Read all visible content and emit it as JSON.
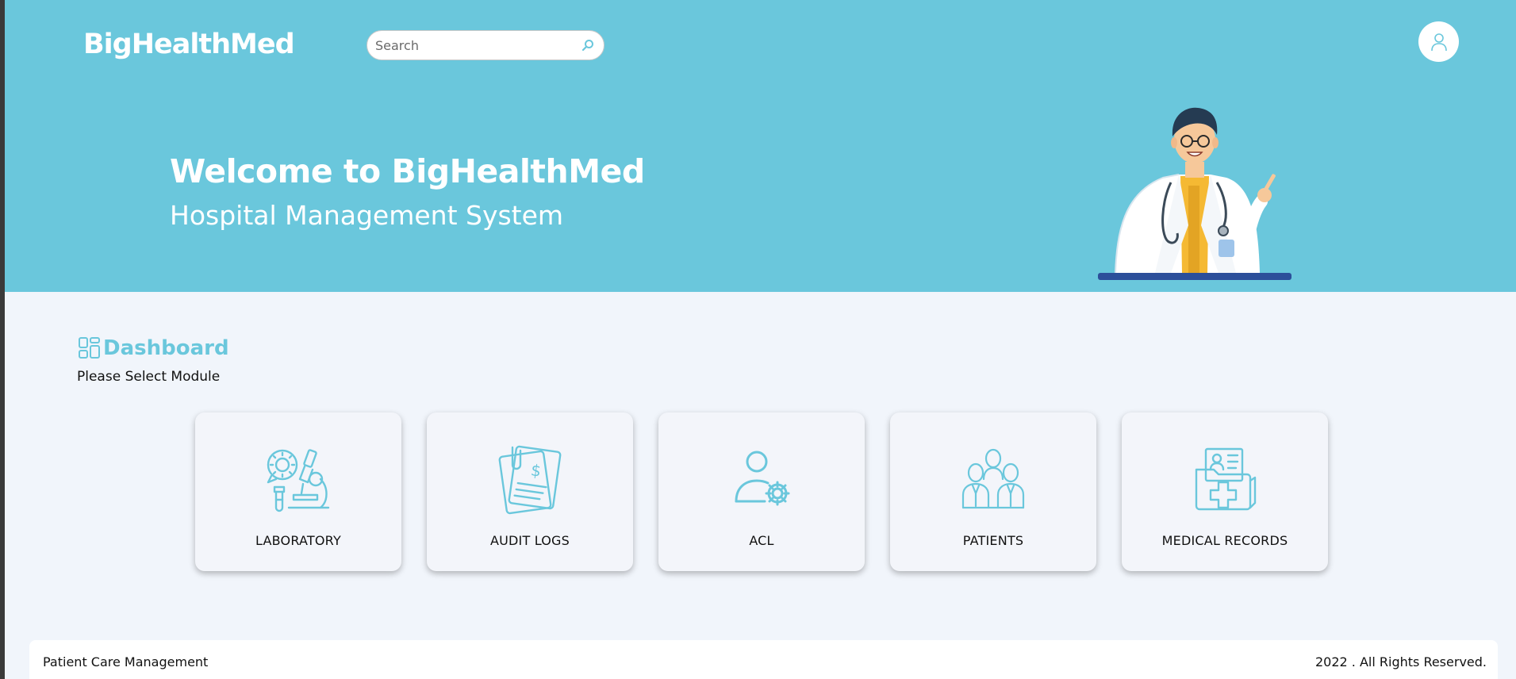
{
  "header": {
    "brand": "BigHealthMed",
    "search_placeholder": "Search"
  },
  "hero": {
    "title": "Welcome to BigHealthMed",
    "subtitle": "Hospital Management System"
  },
  "dashboard": {
    "title": "Dashboard",
    "subtitle": "Please Select Module",
    "modules": [
      {
        "label": "LABORATORY",
        "icon": "microscope-icon"
      },
      {
        "label": "AUDIT LOGS",
        "icon": "invoice-icon"
      },
      {
        "label": "ACL",
        "icon": "user-settings-icon"
      },
      {
        "label": "PATIENTS",
        "icon": "people-group-icon"
      },
      {
        "label": "MEDICAL RECORDS",
        "icon": "medical-folder-icon"
      }
    ]
  },
  "footer": {
    "left": "Patient Care Management",
    "right": "2022 . All Rights Reserved."
  },
  "colors": {
    "accent": "#6ac7dc",
    "background": "#f1f5fb"
  }
}
